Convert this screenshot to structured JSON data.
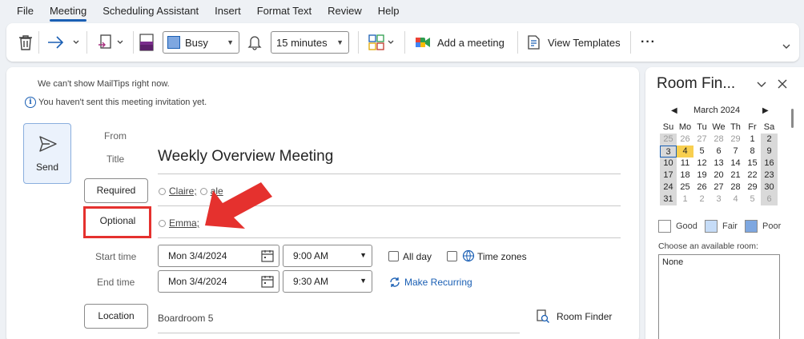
{
  "menu": [
    "File",
    "Meeting",
    "Scheduling Assistant",
    "Insert",
    "Format Text",
    "Review",
    "Help"
  ],
  "ribbon": {
    "show_as": "Busy",
    "reminder": "15 minutes",
    "add_meeting": "Add a meeting",
    "view_templates": "View Templates",
    "more": "···"
  },
  "mailtips": {
    "line1": "We can't show MailTips right now.",
    "line2": "You haven't sent this meeting invitation yet."
  },
  "form": {
    "send_label": "Send",
    "from_label": "From",
    "title_label": "Title",
    "title_value": "Weekly Overview Meeting",
    "required_label": "Required",
    "required_attendees": [
      "Claire;",
      "ale"
    ],
    "optional_label": "Optional",
    "optional_attendees": [
      "Emma;"
    ],
    "start_label": "Start time",
    "start_date": "Mon 3/4/2024",
    "start_time": "9:00 AM",
    "end_label": "End time",
    "end_date": "Mon 3/4/2024",
    "end_time": "9:30 AM",
    "all_day": "All day",
    "time_zones": "Time zones",
    "make_recurring": "Make Recurring",
    "location_label": "Location",
    "location_value": "Boardroom 5",
    "room_finder": "Room Finder"
  },
  "room_finder": {
    "title": "Room Fin...",
    "month": "March 2024",
    "weekdays": [
      "Su",
      "Mo",
      "Tu",
      "We",
      "Th",
      "Fr",
      "Sa"
    ],
    "weeks": [
      [
        "25",
        "26",
        "27",
        "28",
        "29",
        "1",
        "2"
      ],
      [
        "3",
        "4",
        "5",
        "6",
        "7",
        "8",
        "9"
      ],
      [
        "10",
        "11",
        "12",
        "13",
        "14",
        "15",
        "16"
      ],
      [
        "17",
        "18",
        "19",
        "20",
        "21",
        "22",
        "23"
      ],
      [
        "24",
        "25",
        "26",
        "27",
        "28",
        "29",
        "30"
      ],
      [
        "31",
        "1",
        "2",
        "3",
        "4",
        "5",
        "6"
      ]
    ],
    "legend": [
      "Good",
      "Fair",
      "Poor"
    ],
    "choose_label": "Choose an available room:",
    "rooms": [
      "None"
    ]
  },
  "colors": {
    "accent": "#1a5fb4",
    "highlight_red": "#e5312e",
    "selected_day": "#f8cf4f",
    "fair": "#c6dcf7",
    "poor": "#7ea7e0"
  }
}
